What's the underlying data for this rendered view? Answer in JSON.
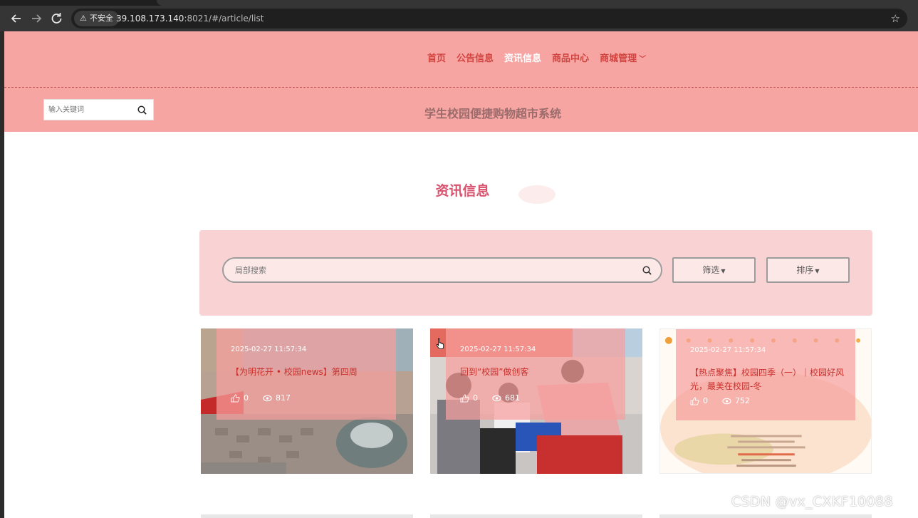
{
  "browser": {
    "back_icon": "arrow-left-icon",
    "forward_icon": "arrow-right-icon",
    "reload_icon": "reload-icon",
    "security_label": "不安全",
    "url_host": "39.108.173.140",
    "url_rest": ":8021/#/article/list",
    "bookmark_icon": "star-icon"
  },
  "header": {
    "nav": [
      {
        "label": "首页",
        "active": false
      },
      {
        "label": "公告信息",
        "active": false
      },
      {
        "label": "资讯信息",
        "active": true
      },
      {
        "label": "商品中心",
        "active": false
      },
      {
        "label": "商城管理",
        "active": false,
        "has_dropdown": true
      }
    ],
    "search_placeholder": "输入关键词",
    "site_title": "学生校园便捷购物超市系统"
  },
  "section_title": "资讯信息",
  "filter": {
    "search_placeholder": "局部搜索",
    "filter_label": "筛选",
    "sort_label": "排序"
  },
  "articles": [
    {
      "date": "2025-02-27 11:57:34",
      "title": "【为明花开 • 校园news】第四周",
      "likes": "0",
      "views": "817"
    },
    {
      "date": "2025-02-27 11:57:34",
      "title": "回到“校园”做创客",
      "likes": "0",
      "views": "681"
    },
    {
      "date": "2025-02-27 11:57:34",
      "title": "【热点聚焦】校园四季（一）｜校园好风光，最美在校园-冬",
      "likes": "0",
      "views": "752"
    }
  ],
  "watermark": "CSDN @vx_CXKF10088",
  "colors": {
    "header_bg": "#f6a5a3",
    "nav_text": "#d2443f",
    "nav_active": "#ffffff",
    "section_title": "#d9536f",
    "panel_bg": "#f9d3d3",
    "card_title": "#c92f2b"
  }
}
